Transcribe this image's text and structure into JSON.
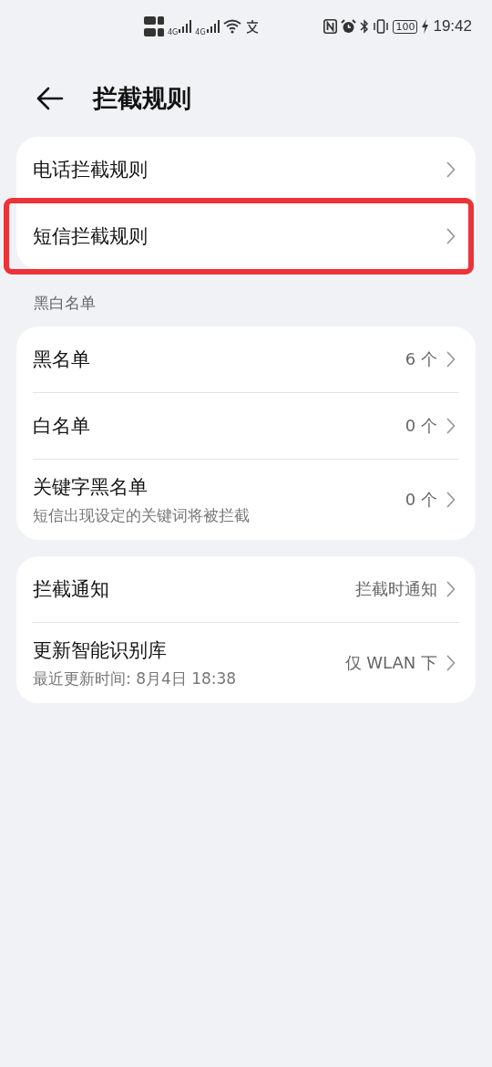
{
  "status_bar": {
    "network": [
      "4G",
      "4G"
    ],
    "battery": "100",
    "time": "19:42"
  },
  "header": {
    "title": "拦截规则"
  },
  "groups": [
    {
      "items": [
        {
          "title": "电话拦截规则",
          "highlighted": false
        },
        {
          "title": "短信拦截规则",
          "highlighted": true
        }
      ]
    },
    {
      "label": "黑白名单",
      "items": [
        {
          "title": "黑名单",
          "value": "6 个",
          "highlighted": false
        },
        {
          "title": "白名单",
          "value": "0 个",
          "highlighted": false
        },
        {
          "title": "关键字黑名单",
          "subtitle": "短信出现设定的关键词将被拦截",
          "value": "0 个",
          "highlighted": false
        }
      ]
    },
    {
      "items": [
        {
          "title": "拦截通知",
          "value": "拦截时通知",
          "highlighted": false
        },
        {
          "title": "更新智能识别库",
          "subtitle": "最近更新时间: 8月4日 18:38",
          "value": "仅 WLAN 下",
          "highlighted": false
        }
      ]
    }
  ]
}
